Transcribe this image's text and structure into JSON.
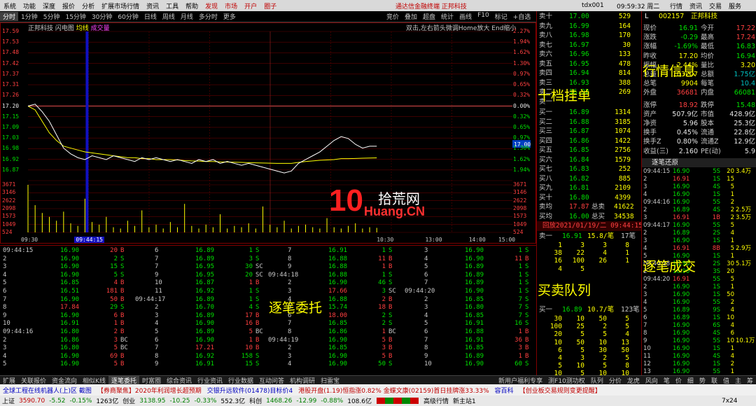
{
  "menubar": {
    "items": [
      "系统",
      "功能",
      "深度",
      "报价",
      "分析",
      "扩展市场行情",
      "资讯",
      "工具",
      "帮助"
    ],
    "red_items": [
      "发现",
      "市场",
      "开户",
      "圈子"
    ],
    "app_title": "通达信金融终端 正邦科技",
    "tdx_label": "tdx001",
    "clock": "09:59:32 周二",
    "right_items": [
      "行情",
      "资讯",
      "交易",
      "服务"
    ]
  },
  "chart_tabs": {
    "tabs": [
      "分时",
      "1分钟",
      "5分钟",
      "15分钟",
      "30分钟",
      "60分钟",
      "日线",
      "周线",
      "月线",
      "多分时",
      "更多"
    ],
    "active": "分时",
    "tools": [
      "竞价",
      "叠加",
      "超盘",
      "统计",
      "画线",
      "F10",
      "标记",
      "+自选",
      "返回"
    ]
  },
  "chart_header": {
    "stock_name": "正邦科技",
    "tab1": "闪电图",
    "tab2": "均线",
    "tab3": "成交量",
    "hint": "双击,左右箭头微调Home放大 End缩小"
  },
  "chart_data": {
    "type": "line",
    "title": "正邦科技",
    "x_times": [
      "09:30",
      "09:44:15",
      "10:30",
      "13:00",
      "14:00",
      "15:00"
    ],
    "price_ticks": [
      "17.59",
      "17.53",
      "17.48",
      "17.42",
      "17.37",
      "17.31",
      "17.26",
      "17.20",
      "17.15",
      "17.09",
      "17.03",
      "16.98",
      "16.92",
      "16.87",
      "3671",
      "3146",
      "2622",
      "2098",
      "1573",
      "1049",
      "524"
    ],
    "pct_ticks": [
      "2.27%",
      "1.94%",
      "1.62%",
      "1.30%",
      "0.97%",
      "0.65%",
      "0.32%",
      "0.00%",
      "0.32%",
      "0.65%",
      "0.97%",
      "1.30%",
      "1.62%",
      "1.94%",
      "3671",
      "3146",
      "2622",
      "2098",
      "1573",
      "1049",
      "524"
    ],
    "current_marker": "17.00",
    "prev_close": 17.2,
    "price_range": [
      16.81,
      17.59
    ],
    "volume_max": 3671,
    "price_series": [
      17.2,
      17.21,
      17.17,
      17.12,
      17.05,
      16.98,
      16.95,
      16.93,
      16.92,
      16.94,
      16.93,
      16.92,
      16.94,
      16.93,
      16.92,
      16.91,
      16.93,
      16.92,
      16.93,
      16.92,
      16.91,
      16.92,
      16.91,
      16.9,
      16.92,
      16.91,
      16.92,
      16.9,
      16.91,
      16.9,
      16.89,
      16.9,
      16.89,
      16.88,
      16.87,
      16.86,
      16.85,
      16.86,
      16.9,
      16.92,
      16.94,
      16.96,
      16.99,
      17.02,
      17.04,
      17.03,
      17.0,
      16.98,
      16.99,
      16.99
    ],
    "avg_series": [
      17.2,
      17.18,
      17.12,
      17.06,
      17.02,
      16.99,
      16.98,
      16.97,
      16.96,
      16.955,
      16.95,
      16.945,
      16.94,
      16.935,
      16.93,
      16.93,
      16.925,
      16.925,
      16.92,
      16.92,
      16.92,
      16.918,
      16.915,
      16.913,
      16.912,
      16.91,
      16.91,
      16.908,
      16.907,
      16.906,
      16.905,
      16.904,
      16.903,
      16.902,
      16.901,
      16.9,
      16.9,
      16.9,
      16.905,
      16.91,
      16.913,
      16.916,
      16.918,
      16.92,
      16.925,
      16.925,
      16.926,
      16.927,
      16.928,
      16.929
    ],
    "volume_series": [
      3671,
      2100,
      1500,
      1200,
      900,
      1600,
      700,
      500,
      2600,
      800,
      600,
      1200,
      400,
      300,
      900,
      500,
      1700,
      400,
      600,
      300,
      800,
      400,
      2200,
      500,
      300,
      600,
      400,
      1400,
      300,
      500,
      400,
      700,
      300,
      2000,
      600,
      400,
      900,
      300,
      500,
      600,
      400,
      300,
      1100,
      400,
      300,
      500,
      700,
      300,
      400,
      350
    ]
  },
  "tick_columns": [
    {
      "start_time": "09:44:15",
      "rows": [
        [
          "",
          "16.90",
          "20",
          "B",
          "6"
        ],
        [
          "2",
          "16.90",
          "2",
          "S",
          "7"
        ],
        [
          "3",
          "16.90",
          "15",
          "S",
          "7"
        ],
        [
          "4",
          "16.90",
          "5",
          "S",
          "9"
        ],
        [
          "5",
          "16.85",
          "4",
          "B",
          "10"
        ],
        [
          "6",
          "16.51",
          "181",
          "B",
          "11"
        ],
        [
          "7",
          "16.90",
          "50",
          "B",
          "09:44:17"
        ],
        [
          "8",
          "17.84",
          "29",
          "S",
          "2"
        ],
        [
          "9",
          "16.90",
          "6",
          "B",
          "3"
        ],
        [
          "10",
          "16.91",
          "1",
          "B",
          "4"
        ],
        [
          "09:44:16",
          "16.80",
          "2",
          "B",
          "5"
        ],
        [
          "2",
          "16.86",
          "3",
          "BC",
          "6"
        ],
        [
          "3",
          "16.80",
          "5",
          "BC",
          "7"
        ],
        [
          "4",
          "16.90",
          "69",
          "B",
          "8"
        ],
        [
          "5",
          "16.90",
          "5",
          "B",
          "9"
        ]
      ]
    },
    {
      "start_time": "",
      "rows": [
        [
          "",
          "16.89",
          "1",
          "S",
          "7"
        ],
        [
          "",
          "16.89",
          "3",
          "S",
          "8"
        ],
        [
          "",
          "16.95",
          "30",
          "SC",
          "9"
        ],
        [
          "",
          "16.95",
          "20",
          "SC",
          "09:44:18"
        ],
        [
          "",
          "16.87",
          "1",
          "B",
          "2"
        ],
        [
          "",
          "16.92",
          "1",
          "S",
          "3"
        ],
        [
          "",
          "16.89",
          "1",
          "S",
          "4"
        ],
        [
          "",
          "16.70",
          "4",
          "S",
          "5"
        ],
        [
          "",
          "16.89",
          "17",
          "B",
          "6"
        ],
        [
          "",
          "16.90",
          "16",
          "B",
          "7"
        ],
        [
          "",
          "16.89",
          "5",
          "BC",
          "8"
        ],
        [
          "",
          "16.90",
          "1",
          "B",
          "09:44:19"
        ],
        [
          "",
          "17.21",
          "10",
          "B",
          "2"
        ],
        [
          "",
          "16.92",
          "158",
          "S",
          "3"
        ],
        [
          "",
          "16.91",
          "15",
          "S",
          "4"
        ]
      ]
    },
    {
      "start_time": "",
      "rows": [
        [
          "",
          "16.91",
          "1",
          "S",
          "3"
        ],
        [
          "",
          "16.88",
          "11",
          "B",
          "4"
        ],
        [
          "",
          "16.88",
          "1",
          "B",
          "5"
        ],
        [
          "",
          "16.88",
          "1",
          "S",
          "6"
        ],
        [
          "",
          "16.90",
          "46",
          "S",
          "7"
        ],
        [
          "",
          "17.66",
          "3",
          "SC",
          "09:44:20"
        ],
        [
          "",
          "16.88",
          "2",
          "B",
          "2"
        ],
        [
          "",
          "15.74",
          "18",
          "B",
          "3"
        ],
        [
          "",
          "18.00",
          "2",
          "S",
          "4"
        ],
        [
          "",
          "16.85",
          "2",
          "S",
          "5"
        ],
        [
          "",
          "16.86",
          "1",
          "BC",
          "6"
        ],
        [
          "",
          "16.90",
          "5",
          "B",
          "7"
        ],
        [
          "",
          "16.85",
          "3",
          "B",
          "8"
        ],
        [
          "",
          "16.90",
          "5",
          "B",
          "9"
        ],
        [
          "",
          "16.90",
          "50",
          "S",
          "10"
        ]
      ]
    },
    {
      "start_time": "",
      "rows": [
        [
          "",
          "16.90",
          "1",
          "S",
          ""
        ],
        [
          "",
          "16.90",
          "11",
          "B",
          ""
        ],
        [
          "",
          "16.89",
          "1",
          "S",
          ""
        ],
        [
          "",
          "16.89",
          "1",
          "S",
          ""
        ],
        [
          "",
          "16.89",
          "1",
          "S",
          ""
        ],
        [
          "",
          "16.90",
          "1",
          "S",
          ""
        ],
        [
          "",
          "16.85",
          "7",
          "S",
          ""
        ],
        [
          "",
          "16.80",
          "7",
          "S",
          ""
        ],
        [
          "",
          "16.85",
          "7",
          "S",
          ""
        ],
        [
          "",
          "16.91",
          "16",
          "S",
          ""
        ],
        [
          "",
          "16.88",
          "1",
          "B",
          ""
        ],
        [
          "",
          "16.91",
          "36",
          "B",
          ""
        ],
        [
          "",
          "16.85",
          "3",
          "B",
          ""
        ],
        [
          "",
          "16.89",
          "1",
          "B",
          ""
        ],
        [
          "",
          "16.90",
          "60",
          "S",
          ""
        ]
      ]
    }
  ],
  "labels": {
    "tape": "逐笔委托",
    "ladder": "十档挂单",
    "queue": "买卖队列",
    "quote": "行情信息",
    "ticks": "逐笔成交"
  },
  "order_book": {
    "sells": [
      [
        "卖十",
        "17.00",
        "529"
      ],
      [
        "卖九",
        "16.99",
        "164"
      ],
      [
        "卖八",
        "16.98",
        "170"
      ],
      [
        "卖七",
        "16.97",
        "30"
      ],
      [
        "卖六",
        "16.96",
        "133"
      ],
      [
        "卖五",
        "16.95",
        "478"
      ],
      [
        "卖四",
        "16.94",
        "814"
      ],
      [
        "卖三",
        "16.93",
        "388"
      ],
      [
        "卖二",
        "16.92",
        "",
        "269"
      ],
      [
        "卖一",
        "",
        "",
        ""
      ]
    ],
    "buys": [
      [
        "买一",
        "16.89",
        "1314"
      ],
      [
        "买二",
        "16.88",
        "3185"
      ],
      [
        "买三",
        "16.87",
        "1074"
      ],
      [
        "买四",
        "16.86",
        "1422"
      ],
      [
        "买五",
        "16.85",
        "2756"
      ],
      [
        "买六",
        "16.84",
        "1579"
      ],
      [
        "买七",
        "16.83",
        "252"
      ],
      [
        "买八",
        "16.82",
        "885"
      ],
      [
        "买九",
        "16.81",
        "2109"
      ],
      [
        "买十",
        "16.80",
        "4399"
      ]
    ],
    "sell_avg": {
      "label": "卖均",
      "price": "17.87",
      "vol_label": "总卖",
      "vol": "41622"
    },
    "buy_avg": {
      "label": "买均",
      "price": "16.00",
      "vol_label": "总买",
      "vol": "34538"
    },
    "replay": "回放2021/01/19/二 09:44:15",
    "sell1_queue": {
      "label": "卖一",
      "price": "16.91",
      "qty": "15.8/笔",
      "count": "17笔"
    },
    "sell1_rows": [
      [
        "1",
        "3",
        "3",
        "8"
      ],
      [
        "38",
        "22",
        "4",
        "1"
      ],
      [
        "16",
        "100",
        "26",
        "1"
      ],
      [
        "4",
        "5",
        "",
        ""
      ]
    ],
    "buy1_queue": {
      "label": "买一",
      "price": "16.89",
      "qty": "10.7/笔",
      "count": "123笔"
    },
    "buy1_rows": [
      [
        "30",
        "10",
        "50",
        "5"
      ],
      [
        "100",
        "25",
        "2",
        "5"
      ],
      [
        "20",
        "5",
        "5",
        "4"
      ],
      [
        "10",
        "50",
        "10",
        "13"
      ],
      [
        "6",
        "5",
        "30",
        "50"
      ],
      [
        "4",
        "3",
        "2",
        "5"
      ],
      [
        "5",
        "10",
        "5",
        "8"
      ],
      [
        "10",
        "5",
        "10",
        "10"
      ],
      [
        "5",
        "10",
        "5",
        "2"
      ],
      [
        "3",
        "5",
        "10",
        "5"
      ],
      [
        "4",
        "3",
        "20",
        "3"
      ],
      [
        "5",
        "10",
        "20",
        "15"
      ],
      [
        "12",
        "5",
        "10",
        "30"
      ]
    ]
  },
  "quote": {
    "code": "002157",
    "name": "正邦科技",
    "tag": "L",
    "rows": [
      [
        "现价",
        "16.91",
        "今开",
        "17.22"
      ],
      [
        "涨跌",
        "-0.29",
        "最高",
        "17.24"
      ],
      [
        "涨幅",
        "-1.69%",
        "最低",
        "16.83"
      ],
      [
        "昨收",
        "17.20",
        "均价",
        "16.94"
      ],
      [
        "振幅",
        "2.44%",
        "量比",
        "3.20"
      ],
      [
        "总量",
        "103207",
        "总额",
        "1.75亿"
      ],
      [
        "总笔",
        "9904",
        "每笔",
        "10.4"
      ],
      [
        "外盘",
        "36681",
        "内盘",
        "66081"
      ],
      [
        "涨停",
        "18.92",
        "跌停",
        "15.48"
      ],
      [
        "资产",
        "507.9亿",
        "市值",
        "428.9亿"
      ],
      [
        "净资",
        "5.96",
        "股本",
        "25.3亿"
      ],
      [
        "换手",
        "0.45%",
        "流通",
        "22.8亿"
      ],
      [
        "换手Z",
        "0.80%",
        "流通Z",
        "12.9亿"
      ],
      [
        "收益(三)",
        "2.160",
        "PE(动)",
        "5.9"
      ]
    ],
    "ticks_title": "逐笔还原",
    "ticks": [
      [
        "09:44:15",
        "16.90",
        "5S",
        "20",
        "3.4万"
      ],
      [
        "2",
        "16.91",
        "1S",
        "15",
        ""
      ],
      [
        "3",
        "16.90",
        "4S",
        "5",
        ""
      ],
      [
        "4",
        "16.90",
        "1S",
        "1",
        ""
      ],
      [
        "09:44:16",
        "16.90",
        "5S",
        "2",
        ""
      ],
      [
        "2",
        "16.89",
        "4S",
        "2",
        "2.5万"
      ],
      [
        "3",
        "16.91",
        "1B",
        "2",
        "3.5万"
      ],
      [
        "09:44:17",
        "16.90",
        "5S",
        "5",
        ""
      ],
      [
        "2",
        "16.89",
        "2S",
        "4",
        ""
      ],
      [
        "3",
        "16.90",
        "1S",
        "1",
        ""
      ],
      [
        "4",
        "16.91",
        "8B",
        "5",
        "2.9万"
      ],
      [
        "5",
        "16.90",
        "1S",
        "1",
        ""
      ],
      [
        "09:44:18",
        "16.90",
        "2S",
        "30",
        "5.1万"
      ],
      [
        "2",
        "16.90",
        "3S",
        "20",
        ""
      ],
      [
        "09:44:20",
        "16.91",
        "5S",
        "5",
        ""
      ],
      [
        "2",
        "16.90",
        "1S",
        "1",
        ""
      ],
      [
        "3",
        "16.90",
        "1S",
        "50",
        ""
      ],
      [
        "4",
        "16.90",
        "5S",
        "2",
        ""
      ],
      [
        "5",
        "16.89",
        "9S",
        "4",
        ""
      ],
      [
        "6",
        "16.89",
        "1S",
        "10",
        ""
      ],
      [
        "7",
        "16.90",
        "6S",
        "4",
        ""
      ],
      [
        "8",
        "16.90",
        "4S",
        "6",
        ""
      ],
      [
        "9",
        "16.90",
        "5S",
        "10",
        "10.1万"
      ],
      [
        "10",
        "16.90",
        "1S",
        "1",
        ""
      ],
      [
        "11",
        "16.90",
        "4S",
        "4",
        ""
      ],
      [
        "12",
        "16.90",
        "1S",
        "2",
        ""
      ],
      [
        "13",
        "16.90",
        "5S",
        "1",
        ""
      ]
    ]
  },
  "watermark": {
    "big": "10",
    "cn": "拾荒网",
    "en": "Huang.CN"
  },
  "bottom_tabs": {
    "tabs": [
      "扩展",
      "关联报价",
      "资金流向",
      "相似K线",
      "逐笔委托",
      "时富圈",
      "综合资讯",
      "行业资讯",
      "行业数据",
      "互动问答",
      "机构调研",
      "扫雷宝"
    ],
    "active": "逐笔委托",
    "right": [
      "新用户福利专享",
      "测F10测功权",
      "队列",
      "分价",
      "龙虎",
      "风向",
      "笔",
      "价",
      "细",
      "势",
      "联",
      "值",
      "主",
      "筹"
    ]
  },
  "ticker": [
    "全球工程在线机器人(上)区 截图",
    "【券商聚焦】2020年利润增长超预期",
    "交银升远软件(01478)目标价4",
    "港股开盘(1.19)恒指涨0.82% 金蝶文康(02159)首日挂牌涨33.33%",
    "容百科",
    "【创业板交易规则变更提醒】"
  ],
  "status": {
    "sh_label": "上证",
    "sh_val": "3590.70",
    "sh_chg": "-5.52",
    "sh_pct": "-0.15%",
    "sh_amt": "1263亿",
    "cy_label": "创业",
    "cy_val": "3138.95",
    "cy_chg": "-10.25",
    "cy_pct": "-0.33%",
    "cy_amt": "552.3亿",
    "kc_label": "科创",
    "kc_val": "1468.26",
    "kc_chg": "-12.99",
    "kc_pct": "-0.88%",
    "kc_amt": "108.6亿",
    "mode": "高级行情",
    "site": "新主站1",
    "right": "7x24"
  },
  "colors": {
    "up": "#ff4040",
    "down": "#00e000",
    "price_line": "#ffffff",
    "avg_line": "#ffff00",
    "volume": "#ffff00",
    "border": "#800000"
  }
}
